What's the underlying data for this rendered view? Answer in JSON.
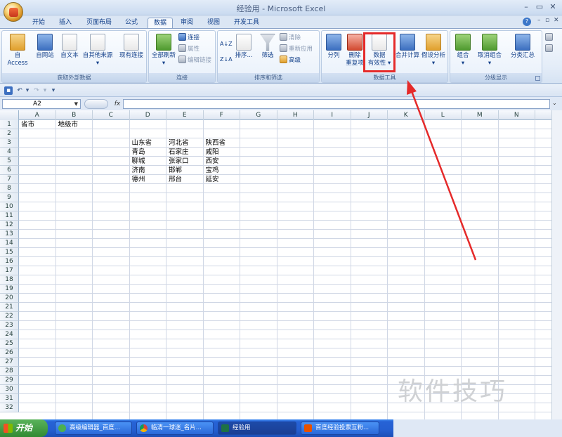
{
  "window": {
    "title": "经验用 - Microsoft Excel"
  },
  "tabs": [
    "开始",
    "插入",
    "页面布局",
    "公式",
    "数据",
    "审阅",
    "视图",
    "开发工具"
  ],
  "active_tab": "数据",
  "ribbon": {
    "groups": {
      "external": {
        "label": "获取外部数据",
        "buttons": [
          "自 Access",
          "自网站",
          "自文本",
          "自其他来源",
          "现有连接"
        ]
      },
      "connections": {
        "label": "连接",
        "refresh_all": "全部刷新",
        "connections": "连接",
        "properties": "属性",
        "edit_links": "编辑链接"
      },
      "sort_filter": {
        "label": "排序和筛选",
        "sort": "排序...",
        "filter": "筛选",
        "clear": "清除",
        "reapply": "重新应用",
        "advanced": "高级",
        "az": "A↓Z",
        "za": "Z↓A"
      },
      "data_tools": {
        "label": "数据工具",
        "text_to_columns": "分列",
        "remove_duplicates_1": "删除",
        "remove_duplicates_2": "重复项",
        "data_validation_1": "数据",
        "data_validation_2": "有效性",
        "consolidate": "合并计算",
        "what_if": "假设分析"
      },
      "outline": {
        "label": "分级显示",
        "group": "组合",
        "ungroup": "取消组合",
        "subtotal": "分类汇总"
      }
    }
  },
  "formula_bar": {
    "name_box": "A2",
    "fx": "fx",
    "value": ""
  },
  "columns": [
    "A",
    "B",
    "C",
    "D",
    "E",
    "F",
    "G",
    "H",
    "I",
    "J",
    "K",
    "L",
    "M",
    "N"
  ],
  "rows": [
    "1",
    "2",
    "3",
    "4",
    "5",
    "6",
    "7",
    "8",
    "9",
    "10",
    "11",
    "12",
    "13",
    "14",
    "15",
    "16",
    "17",
    "18",
    "19",
    "20",
    "21",
    "22",
    "23",
    "24",
    "25",
    "26",
    "27",
    "28",
    "29",
    "30",
    "31",
    "32"
  ],
  "cells": {
    "A1": "省市",
    "B1": "地级市",
    "D3": "山东省",
    "E3": "河北省",
    "F3": "陕西省",
    "D4": "青岛",
    "E4": "石家庄",
    "F4": "咸阳",
    "D5": "聊城",
    "E5": "张家口",
    "F5": "西安",
    "D6": "济南",
    "E6": "邯郸",
    "F6": "宝鸡",
    "D7": "德州",
    "E7": "邢台",
    "F7": "延安"
  },
  "watermark": "软件技巧",
  "taskbar": {
    "start": "开始",
    "tasks": [
      "高级编辑器_百度...",
      "临清一球迷_名片...",
      "经验用",
      "百度经验投票互粉..."
    ]
  },
  "colors": {
    "highlight": "#e52a2a",
    "ribbon_bg": "#dfe8f5",
    "taskbar": "#245ed0"
  }
}
